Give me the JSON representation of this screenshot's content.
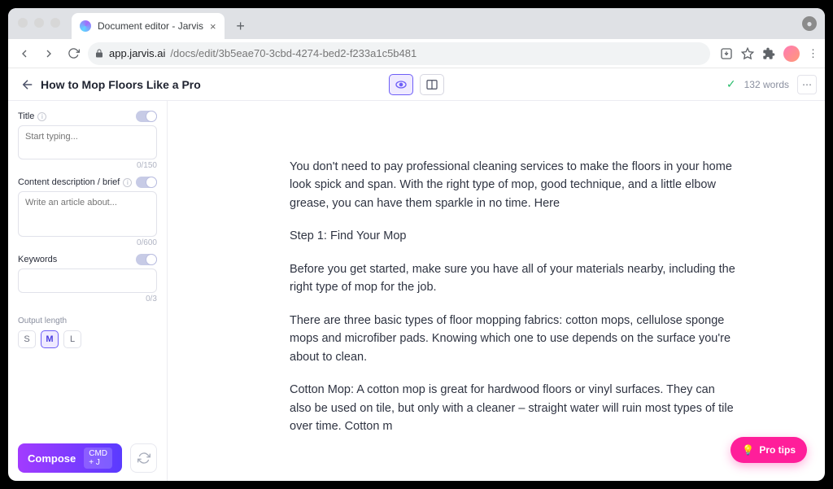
{
  "chrome": {
    "tab_title": "Document editor - Jarvis",
    "url_host": "app.jarvis.ai",
    "url_path": "/docs/edit/3b5eae70-3cbd-4274-bed2-f233a1c5b481"
  },
  "header": {
    "title": "How to Mop Floors Like a Pro",
    "word_count": "132 words"
  },
  "sidebar": {
    "title": {
      "label": "Title",
      "placeholder": "Start typing...",
      "counter": "0/150"
    },
    "brief": {
      "label": "Content description / brief",
      "placeholder": "Write an article about...",
      "counter": "0/600"
    },
    "keywords": {
      "label": "Keywords",
      "counter": "0/3"
    },
    "output_length": {
      "label": "Output length",
      "options": [
        "S",
        "M",
        "L"
      ],
      "selected": "M"
    },
    "compose_label": "Compose",
    "compose_shortcut": "CMD + J"
  },
  "document": {
    "paragraphs": [
      "You don't need to pay professional cleaning services to make the floors in your home look spick and span. With the right type of mop, good technique, and a little elbow grease, you can have them sparkle in no time. Here",
      "Step 1: Find Your Mop",
      "Before you get started, make sure you have all of your materials nearby, including the right type of mop for the job.",
      "There are three basic types of floor mopping fabrics: cotton mops, cellulose sponge mops and microfiber pads. Knowing which one to use depends on the surface you're about to clean.",
      "Cotton Mop: A cotton mop is great for hardwood floors or vinyl surfaces. They can also be used on tile, but only with a cleaner – straight water will ruin most types of tile over time. Cotton m"
    ]
  },
  "footer": {
    "pro_tips": "Pro tips"
  }
}
